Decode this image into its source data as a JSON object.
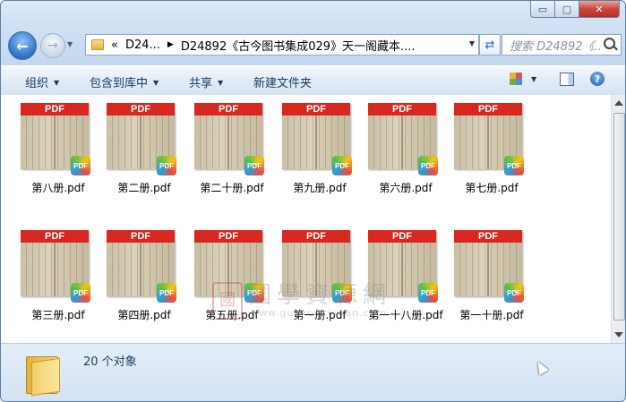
{
  "window": {
    "caption_buttons": {
      "minimize": "▭",
      "maximize": "▢",
      "close": "✕"
    }
  },
  "nav": {
    "back_icon": "back-arrow-icon",
    "forward_icon": "forward-arrow-icon",
    "address_overflow": "«",
    "breadcrumb_1": "D24...",
    "breadcrumb_2": "D24892《古今图书集成029》天一阁藏本....",
    "search_placeholder": "搜索 D24892《...",
    "refresh_icon": "refresh-icon"
  },
  "toolbar": {
    "organize": "组织",
    "include_in_library": "包含到库中",
    "share": "共享",
    "new_folder": "新建文件夹",
    "help": "?"
  },
  "files": [
    {
      "name": "第八册.pdf"
    },
    {
      "name": "第二册.pdf"
    },
    {
      "name": "第二十册.pdf"
    },
    {
      "name": "第九册.pdf"
    },
    {
      "name": "第六册.pdf"
    },
    {
      "name": "第七册.pdf"
    },
    {
      "name": "第三册.pdf"
    },
    {
      "name": "第四册.pdf"
    },
    {
      "name": "第五册.pdf"
    },
    {
      "name": "第一册.pdf"
    },
    {
      "name": "第一十八册.pdf"
    },
    {
      "name": "第一十册.pdf"
    }
  ],
  "thumbnail": {
    "banner": "PDF",
    "badge": "PDF"
  },
  "watermark": {
    "seal": "國",
    "title": "國學資源網",
    "url": "www.guoxueziyuan.com"
  },
  "status": {
    "count": "20 个对象"
  },
  "colors": {
    "pdf_red": "#d8271e",
    "accent": "#1e395b"
  }
}
